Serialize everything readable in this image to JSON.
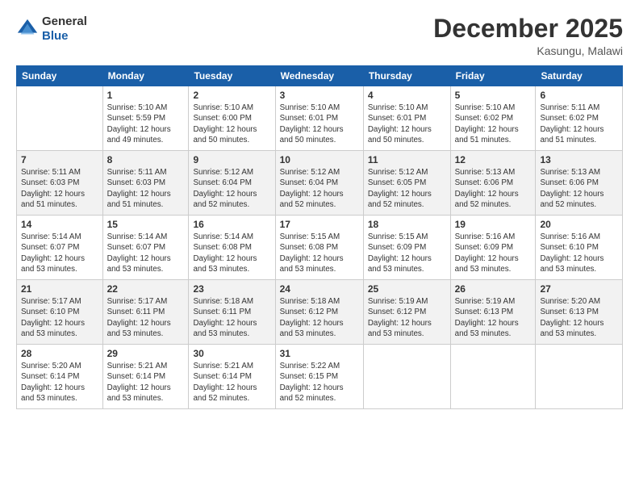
{
  "header": {
    "logo_general": "General",
    "logo_blue": "Blue",
    "month_title": "December 2025",
    "location": "Kasungu, Malawi"
  },
  "calendar": {
    "days_of_week": [
      "Sunday",
      "Monday",
      "Tuesday",
      "Wednesday",
      "Thursday",
      "Friday",
      "Saturday"
    ],
    "weeks": [
      [
        {
          "day": "",
          "info": ""
        },
        {
          "day": "1",
          "info": "Sunrise: 5:10 AM\nSunset: 5:59 PM\nDaylight: 12 hours\nand 49 minutes."
        },
        {
          "day": "2",
          "info": "Sunrise: 5:10 AM\nSunset: 6:00 PM\nDaylight: 12 hours\nand 50 minutes."
        },
        {
          "day": "3",
          "info": "Sunrise: 5:10 AM\nSunset: 6:01 PM\nDaylight: 12 hours\nand 50 minutes."
        },
        {
          "day": "4",
          "info": "Sunrise: 5:10 AM\nSunset: 6:01 PM\nDaylight: 12 hours\nand 50 minutes."
        },
        {
          "day": "5",
          "info": "Sunrise: 5:10 AM\nSunset: 6:02 PM\nDaylight: 12 hours\nand 51 minutes."
        },
        {
          "day": "6",
          "info": "Sunrise: 5:11 AM\nSunset: 6:02 PM\nDaylight: 12 hours\nand 51 minutes."
        }
      ],
      [
        {
          "day": "7",
          "info": "Sunrise: 5:11 AM\nSunset: 6:03 PM\nDaylight: 12 hours\nand 51 minutes."
        },
        {
          "day": "8",
          "info": "Sunrise: 5:11 AM\nSunset: 6:03 PM\nDaylight: 12 hours\nand 51 minutes."
        },
        {
          "day": "9",
          "info": "Sunrise: 5:12 AM\nSunset: 6:04 PM\nDaylight: 12 hours\nand 52 minutes."
        },
        {
          "day": "10",
          "info": "Sunrise: 5:12 AM\nSunset: 6:04 PM\nDaylight: 12 hours\nand 52 minutes."
        },
        {
          "day": "11",
          "info": "Sunrise: 5:12 AM\nSunset: 6:05 PM\nDaylight: 12 hours\nand 52 minutes."
        },
        {
          "day": "12",
          "info": "Sunrise: 5:13 AM\nSunset: 6:06 PM\nDaylight: 12 hours\nand 52 minutes."
        },
        {
          "day": "13",
          "info": "Sunrise: 5:13 AM\nSunset: 6:06 PM\nDaylight: 12 hours\nand 52 minutes."
        }
      ],
      [
        {
          "day": "14",
          "info": "Sunrise: 5:14 AM\nSunset: 6:07 PM\nDaylight: 12 hours\nand 53 minutes."
        },
        {
          "day": "15",
          "info": "Sunrise: 5:14 AM\nSunset: 6:07 PM\nDaylight: 12 hours\nand 53 minutes."
        },
        {
          "day": "16",
          "info": "Sunrise: 5:14 AM\nSunset: 6:08 PM\nDaylight: 12 hours\nand 53 minutes."
        },
        {
          "day": "17",
          "info": "Sunrise: 5:15 AM\nSunset: 6:08 PM\nDaylight: 12 hours\nand 53 minutes."
        },
        {
          "day": "18",
          "info": "Sunrise: 5:15 AM\nSunset: 6:09 PM\nDaylight: 12 hours\nand 53 minutes."
        },
        {
          "day": "19",
          "info": "Sunrise: 5:16 AM\nSunset: 6:09 PM\nDaylight: 12 hours\nand 53 minutes."
        },
        {
          "day": "20",
          "info": "Sunrise: 5:16 AM\nSunset: 6:10 PM\nDaylight: 12 hours\nand 53 minutes."
        }
      ],
      [
        {
          "day": "21",
          "info": "Sunrise: 5:17 AM\nSunset: 6:10 PM\nDaylight: 12 hours\nand 53 minutes."
        },
        {
          "day": "22",
          "info": "Sunrise: 5:17 AM\nSunset: 6:11 PM\nDaylight: 12 hours\nand 53 minutes."
        },
        {
          "day": "23",
          "info": "Sunrise: 5:18 AM\nSunset: 6:11 PM\nDaylight: 12 hours\nand 53 minutes."
        },
        {
          "day": "24",
          "info": "Sunrise: 5:18 AM\nSunset: 6:12 PM\nDaylight: 12 hours\nand 53 minutes."
        },
        {
          "day": "25",
          "info": "Sunrise: 5:19 AM\nSunset: 6:12 PM\nDaylight: 12 hours\nand 53 minutes."
        },
        {
          "day": "26",
          "info": "Sunrise: 5:19 AM\nSunset: 6:13 PM\nDaylight: 12 hours\nand 53 minutes."
        },
        {
          "day": "27",
          "info": "Sunrise: 5:20 AM\nSunset: 6:13 PM\nDaylight: 12 hours\nand 53 minutes."
        }
      ],
      [
        {
          "day": "28",
          "info": "Sunrise: 5:20 AM\nSunset: 6:14 PM\nDaylight: 12 hours\nand 53 minutes."
        },
        {
          "day": "29",
          "info": "Sunrise: 5:21 AM\nSunset: 6:14 PM\nDaylight: 12 hours\nand 53 minutes."
        },
        {
          "day": "30",
          "info": "Sunrise: 5:21 AM\nSunset: 6:14 PM\nDaylight: 12 hours\nand 52 minutes."
        },
        {
          "day": "31",
          "info": "Sunrise: 5:22 AM\nSunset: 6:15 PM\nDaylight: 12 hours\nand 52 minutes."
        },
        {
          "day": "",
          "info": ""
        },
        {
          "day": "",
          "info": ""
        },
        {
          "day": "",
          "info": ""
        }
      ]
    ]
  }
}
